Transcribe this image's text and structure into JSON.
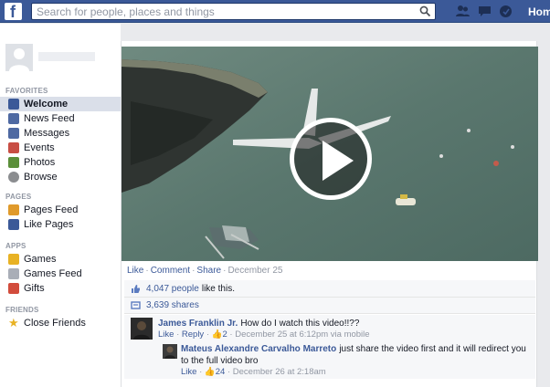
{
  "topbar": {
    "logo": "f",
    "search_placeholder": "Search for people, places and things",
    "home_label": "Home",
    "icons": [
      "friend-requests-icon",
      "messages-icon",
      "notifications-icon",
      "settings-icon"
    ]
  },
  "sidebar": {
    "favorites_header": "FAVORITES",
    "favorites": [
      {
        "label": "Welcome",
        "icon": "facebook-icon",
        "color": "#3b5998",
        "active": true
      },
      {
        "label": "News Feed",
        "icon": "news-feed-icon",
        "color": "#4e69a2"
      },
      {
        "label": "Messages",
        "icon": "messages-icon",
        "color": "#4e69a2"
      },
      {
        "label": "Events",
        "icon": "events-icon",
        "color": "#c84e44"
      },
      {
        "label": "Photos",
        "icon": "photos-icon",
        "color": "#5b8f3a"
      },
      {
        "label": "Browse",
        "icon": "browse-icon",
        "color": "#8b8d90"
      }
    ],
    "pages_header": "PAGES",
    "pages": [
      {
        "label": "Pages Feed",
        "icon": "pages-feed-icon",
        "color": "#e09a2b"
      },
      {
        "label": "Like Pages",
        "icon": "like-pages-icon",
        "color": "#3b5998"
      }
    ],
    "apps_header": "APPS",
    "apps": [
      {
        "label": "Games",
        "icon": "games-icon",
        "color": "#e8b224"
      },
      {
        "label": "Games Feed",
        "icon": "games-feed-icon",
        "color": "#a9aeb7"
      },
      {
        "label": "Gifts",
        "icon": "gifts-icon",
        "color": "#d24c3c"
      }
    ],
    "friends_header": "FRIENDS",
    "friends": [
      {
        "label": "Close Friends",
        "icon": "star-icon",
        "color": "#e8b224"
      }
    ]
  },
  "post": {
    "actions": {
      "like": "Like",
      "comment": "Comment",
      "share": "Share",
      "date": "December 25"
    },
    "likes_count": "4,047 people",
    "likes_suffix": "like this.",
    "shares": "3,639 shares"
  },
  "comments": [
    {
      "author": "James Franklin Jr.",
      "text": "How do I watch this video!!??",
      "like": "Like",
      "reply": "Reply",
      "like_count": "2",
      "meta": "December 25 at 6:12pm via mobile"
    },
    {
      "author": "Mateus Alexandre Carvalho Marreto",
      "text": "just share the video first and it will redirect you to the full video bro",
      "like": "Like",
      "like_count": "24",
      "meta": "December 26 at 2:18am"
    }
  ]
}
